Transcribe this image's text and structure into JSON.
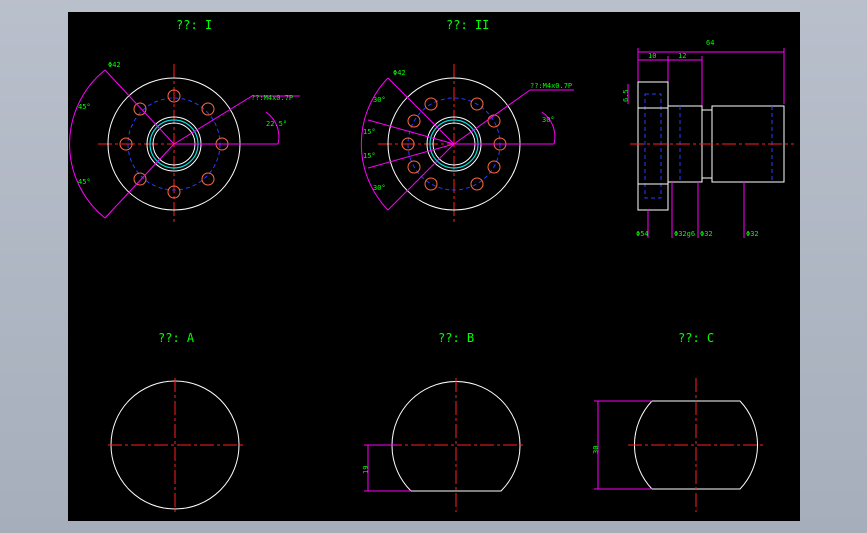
{
  "colors": {
    "background": "#000000",
    "outline": "#ffffff",
    "centerline": "#ff2020",
    "dimension": "#ff00ff",
    "hidden": "#2a3cff",
    "text": "#00ff00",
    "hole": "#ff6a3d",
    "bore": "#00e0e0"
  },
  "views": {
    "view1_title": "??: I",
    "view2_title": "??: II",
    "viewA_title": "??: A",
    "viewB_title": "??: B",
    "viewC_title": "??: C"
  },
  "dims": {
    "v1_dia": "Φ42",
    "v1_thread": "??:M4x0.7P",
    "v1_ang_top": "45°",
    "v1_ang_bot": "45°",
    "v1_ang_right": "22.5°",
    "v2_dia": "Φ42",
    "v2_thread": "??:M4x0.7P",
    "v2_ang_1": "30°",
    "v2_ang_2": "15°",
    "v2_ang_3": "15°",
    "v2_ang_4": "30°",
    "v2_ang_right": "30°",
    "side_len_total": "64",
    "side_len_flange": "10",
    "side_len_neck": "12",
    "side_thick": "6.5",
    "side_d1": "Φ54",
    "side_d2": "Φ32g6",
    "side_d3": "Φ32",
    "side_d4": "Φ32",
    "viewB_flat": "19",
    "viewC_flat": "30"
  }
}
